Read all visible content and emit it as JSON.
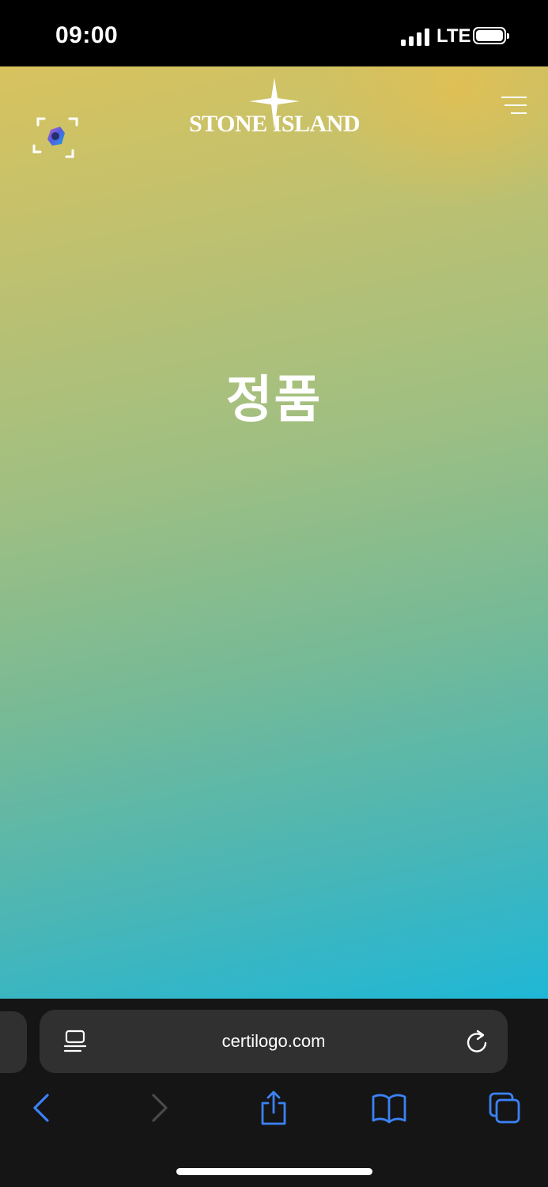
{
  "status_bar": {
    "time": "09:00",
    "network": "LTE",
    "signal_bars": 4,
    "battery_level": 1.0,
    "icons": [
      "signal-icon",
      "battery-icon"
    ]
  },
  "header": {
    "scan_icon": "scan-authenticity-icon",
    "logo_text": "STONE ISLAND",
    "logo_mark": "compass-star-icon",
    "menu_icon": "menu-icon"
  },
  "main": {
    "headline": "정품"
  },
  "browser": {
    "url": "certilogo.com",
    "icons": {
      "page_menu": "page-menu-icon",
      "reload": "reload-icon",
      "back": "back-chevron-icon",
      "forward": "forward-chevron-icon",
      "share": "share-icon",
      "bookmarks": "bookmarks-icon",
      "tabs": "tabs-icon"
    }
  },
  "colors": {
    "gradient_top": "#d8c25e",
    "gradient_bottom": "#1fb7d6",
    "accent_blue": "#3b82f6",
    "toolbar_bg": "#151515"
  }
}
